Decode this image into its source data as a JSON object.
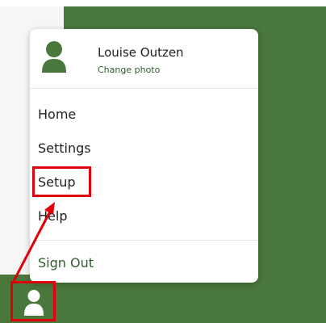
{
  "user": {
    "name": "Louise Outzen",
    "change_photo": "Change photo"
  },
  "menu": {
    "items": [
      {
        "label": "Home"
      },
      {
        "label": "Settings"
      },
      {
        "label": "Setup"
      },
      {
        "label": "Help"
      }
    ],
    "sign_out": "Sign Out"
  },
  "colors": {
    "accent_green": "#4a773c",
    "annotation_red": "#e0000a"
  },
  "icons": {
    "profile": "user-icon",
    "account_button": "user-icon"
  }
}
